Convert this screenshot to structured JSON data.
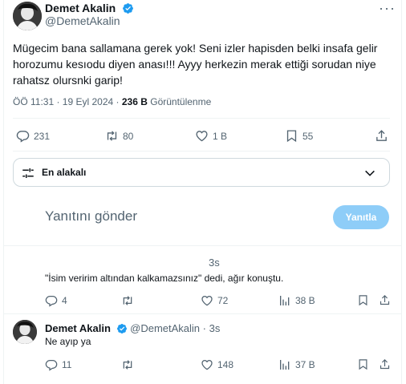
{
  "main_tweet": {
    "author_name": "Demet Akalin",
    "author_handle": "@DemetAkalin",
    "text": "Mügecim bana sallamana gerek yok! Seni izler hapisden belki insafa gelir horozumu kesıodu diyen anası!!! Ayyy herkezin merak ettiği sorudan niye rahatsz olursnki garip!",
    "timestamp": "ÖÖ 11:31 · 19 Eyl 2024 ·",
    "views_count": "236 B",
    "views_label": "Görüntülenme",
    "actions": {
      "replies": "231",
      "reposts": "80",
      "likes": "1 B",
      "bookmarks": "55"
    }
  },
  "filter": {
    "label": "En alakalı"
  },
  "reply_box": {
    "placeholder": "Yanıtını gönder",
    "button_label": "Yanıtla"
  },
  "comments": [
    {
      "time": "3s",
      "text": "\"İsim veririm altından kalkamazsınız\" dedi, ağır konuştu.",
      "replies": "4",
      "likes": "72",
      "views": "38 B"
    },
    {
      "author_name": "Demet Akalin",
      "author_handle": "@DemetAkalin",
      "separator": "·",
      "time": "3s",
      "text": "Ne ayıp ya",
      "replies": "11",
      "likes": "148",
      "views": "37 B"
    }
  ],
  "colors": {
    "text": "#0f1419",
    "secondary": "#536471",
    "verified": "#1d9bf0",
    "button_disabled": "#8ecdf8",
    "border": "#cfd9de",
    "divider": "#eff3f4"
  },
  "icons": [
    "verified-badge-icon",
    "more-icon",
    "reply-icon",
    "repost-icon",
    "like-icon",
    "bookmark-icon",
    "share-icon",
    "views-icon",
    "filter-icon",
    "chevron-down-icon"
  ]
}
